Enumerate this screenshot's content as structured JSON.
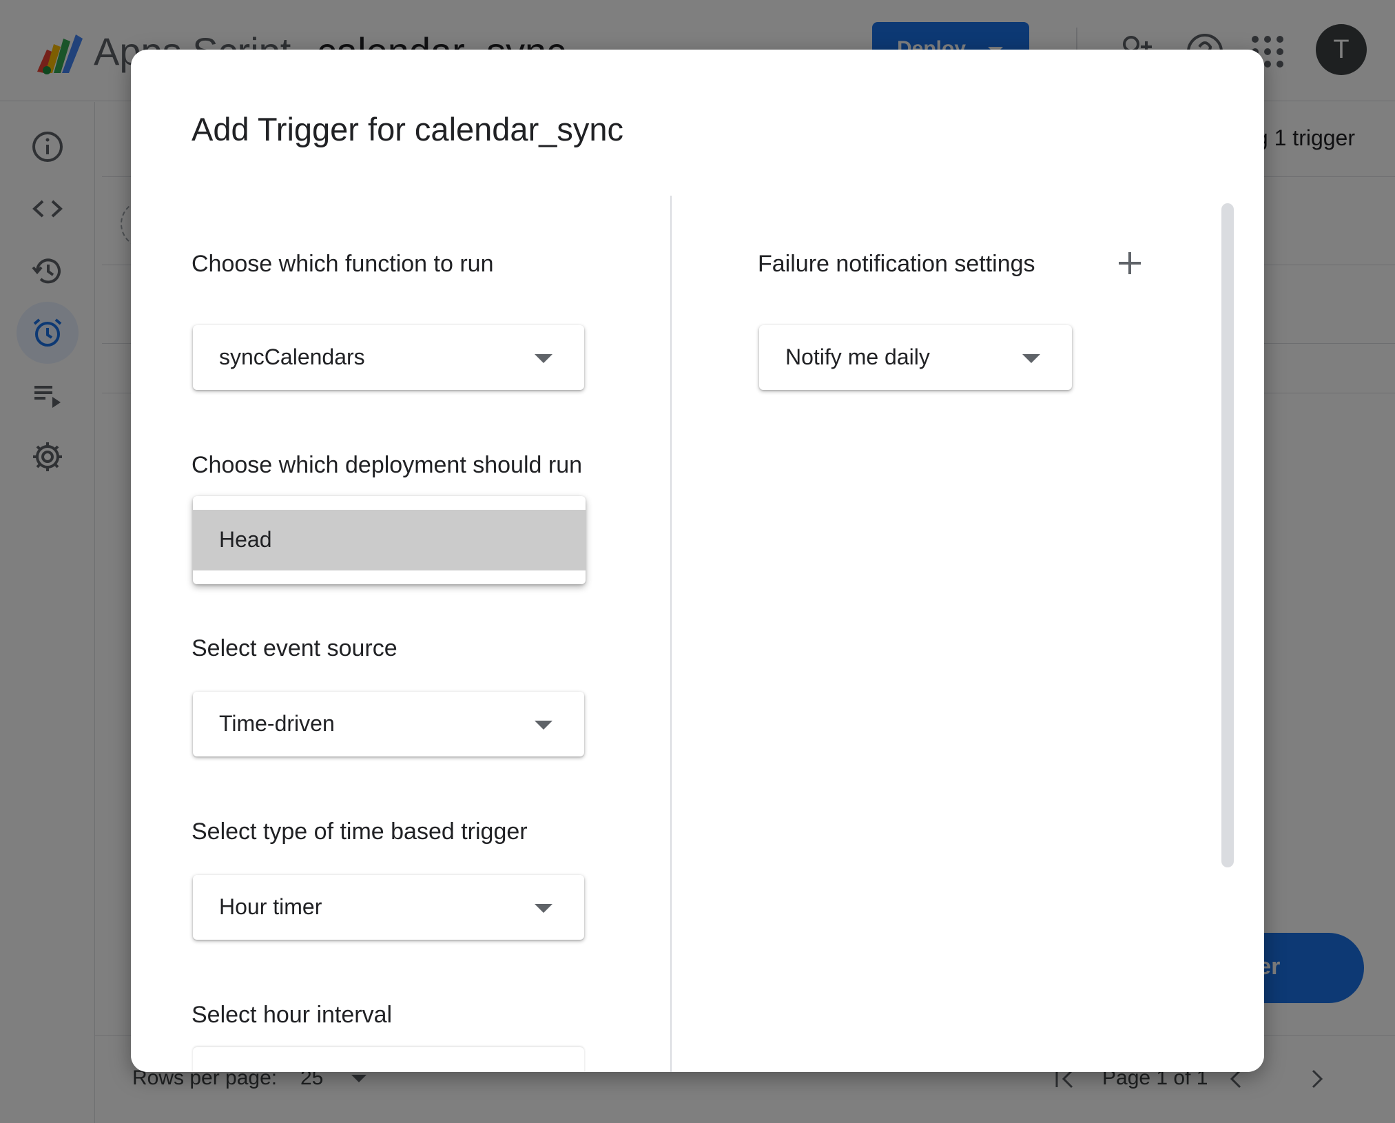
{
  "app": {
    "name": "Apps Script",
    "project_name": "calendar_sync",
    "deploy_label": "Deploy",
    "avatar_initial": "T"
  },
  "sidebar": {
    "items": [
      {
        "icon": "info-icon",
        "label": "Overview"
      },
      {
        "icon": "code-icon",
        "label": "Editor"
      },
      {
        "icon": "history-icon",
        "label": "Executions"
      },
      {
        "icon": "alarm-icon",
        "label": "Triggers",
        "active": true
      },
      {
        "icon": "playlist-icon",
        "label": "Executions log"
      },
      {
        "icon": "gear-icon",
        "label": "Project Settings"
      }
    ]
  },
  "main": {
    "header_text": "g 1 trigger",
    "fab_label": "rigger"
  },
  "pager": {
    "rows_label": "Rows per page:",
    "rows_value": "25",
    "page_label": "Page 1 of 1"
  },
  "dialog": {
    "title": "Add Trigger for calendar_sync",
    "function_label": "Choose which function to run",
    "function_value": "syncCalendars",
    "deployment_label": "Choose which deployment should run",
    "deployment_options": [
      "Head"
    ],
    "event_source_label": "Select event source",
    "event_source_value": "Time-driven",
    "time_type_label": "Select type of time based trigger",
    "time_type_value": "Hour timer",
    "hour_interval_label": "Select hour interval",
    "failure_label": "Failure notification settings",
    "failure_value": "Notify me daily"
  },
  "colors": {
    "accent": "#1a73e8",
    "overlay": "rgba(0,0,0,0.5)",
    "option_highlight": "#cbcbcb"
  }
}
